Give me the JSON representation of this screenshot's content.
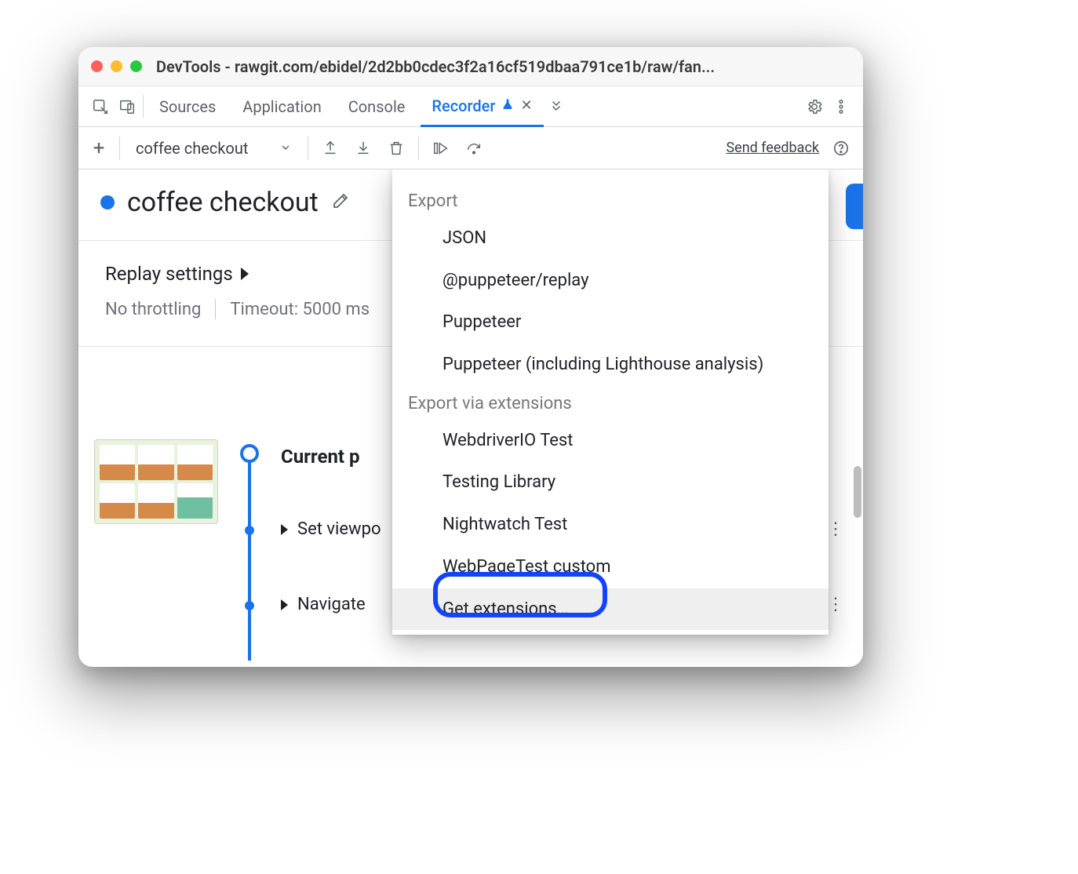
{
  "window": {
    "title": "DevTools - rawgit.com/ebidel/2d2bb0cdec3f2a16cf519dbaa791ce1b/raw/fan..."
  },
  "tabs": {
    "items": [
      "Sources",
      "Application",
      "Console",
      "Recorder"
    ],
    "active": "Recorder"
  },
  "toolbar": {
    "recording_name": "coffee checkout",
    "feedback": "Send feedback"
  },
  "recording": {
    "title": "coffee checkout",
    "settings_label": "Replay settings",
    "throttling": "No throttling",
    "timeout": "Timeout: 5000 ms"
  },
  "steps": {
    "current_label": "Current p",
    "items": [
      "Set viewpo",
      "Navigate"
    ]
  },
  "export_menu": {
    "section1": "Export",
    "items1": [
      "JSON",
      "@puppeteer/replay",
      "Puppeteer",
      "Puppeteer (including Lighthouse analysis)"
    ],
    "section2": "Export via extensions",
    "items2": [
      "WebdriverIO Test",
      "Testing Library",
      "Nightwatch Test",
      "WebPageTest custom",
      "Get extensions…"
    ]
  }
}
